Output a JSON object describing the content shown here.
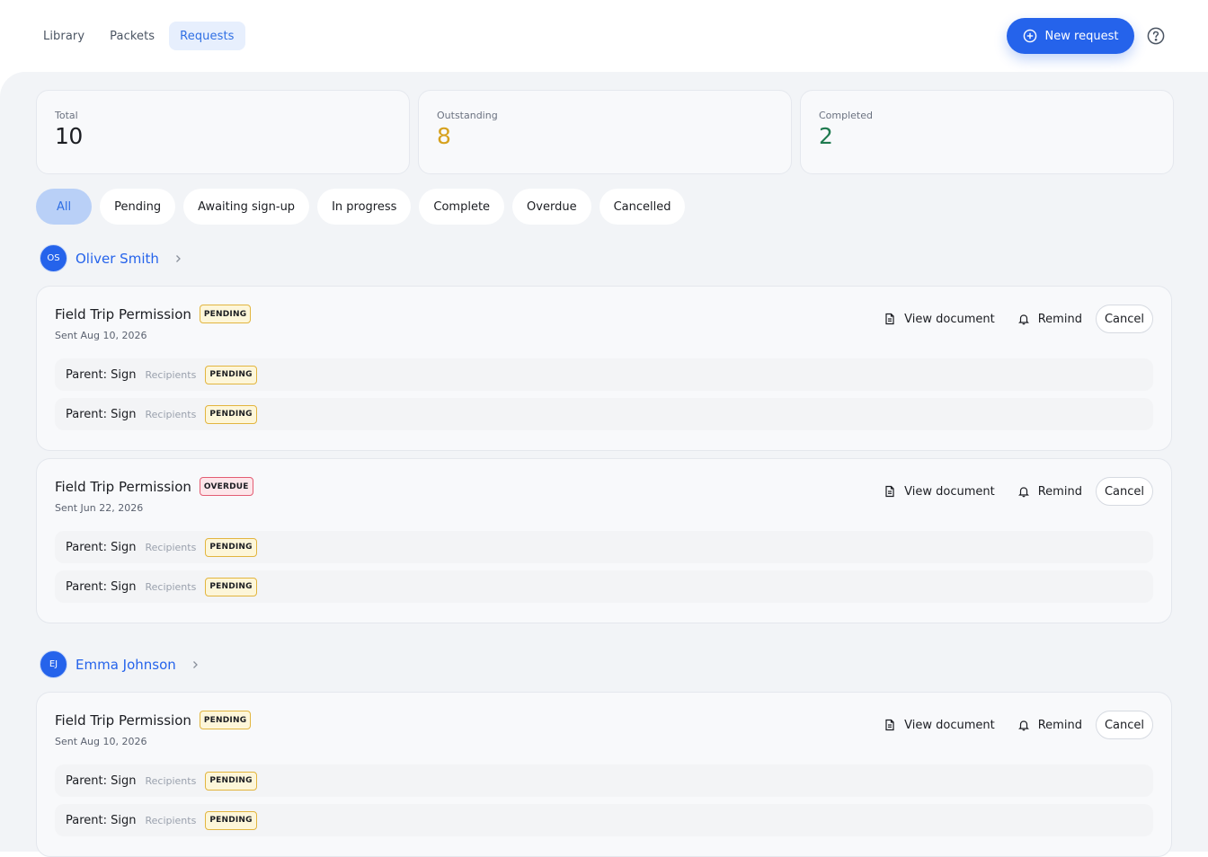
{
  "nav": {
    "tabs": [
      {
        "label": "Library"
      },
      {
        "label": "Packets"
      },
      {
        "label": "Requests"
      }
    ]
  },
  "header": {
    "new_request_label": "New request",
    "help_icon": "help-circle-icon"
  },
  "stats": [
    {
      "label": "Total",
      "value": "10",
      "color": "#1b1d22"
    },
    {
      "label": "Outstanding",
      "value": "8",
      "color": "#d6a11e"
    },
    {
      "label": "Completed",
      "value": "2",
      "color": "#1f7a4f"
    }
  ],
  "filters": [
    "All",
    "Pending",
    "Awaiting sign-up",
    "In progress",
    "Complete",
    "Overdue",
    "Cancelled"
  ],
  "actions": {
    "view": "View document",
    "remind": "Remind",
    "cancel": "Cancel"
  },
  "groups": [
    {
      "initials": "OS",
      "name": "Oliver Smith",
      "requests": [
        {
          "title": "Field Trip Permission",
          "status": "PENDING",
          "sent": "Sent Aug 10, 2026",
          "steps": [
            {
              "label": "Parent: Sign",
              "recipients": "Recipients",
              "status": "PENDING"
            },
            {
              "label": "Parent: Sign",
              "recipients": "Recipients",
              "status": "PENDING"
            }
          ]
        },
        {
          "title": "Field Trip Permission",
          "status": "OVERDUE",
          "sent": "Sent Jun 22, 2026",
          "steps": [
            {
              "label": "Parent: Sign",
              "recipients": "Recipients",
              "status": "PENDING"
            },
            {
              "label": "Parent: Sign",
              "recipients": "Recipients",
              "status": "PENDING"
            }
          ]
        }
      ]
    },
    {
      "initials": "EJ",
      "name": "Emma Johnson",
      "requests": [
        {
          "title": "Field Trip Permission",
          "status": "PENDING",
          "sent": "Sent Aug 10, 2026",
          "steps": [
            {
              "label": "Parent: Sign",
              "recipients": "Recipients",
              "status": "PENDING"
            },
            {
              "label": "Parent: Sign",
              "recipients": "Recipients",
              "status": "PENDING"
            }
          ]
        }
      ]
    }
  ]
}
